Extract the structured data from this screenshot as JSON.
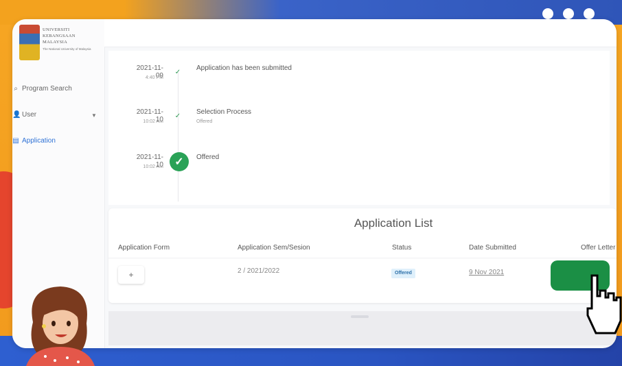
{
  "logo": {
    "lines": [
      "UNIVERSITI",
      "KEBANGSAAN",
      "MALAYSIA"
    ],
    "tagline": "The National University of Malaysia"
  },
  "sidebar": {
    "items": [
      {
        "label": "Program Search",
        "icon": "search-icon"
      },
      {
        "label": "User",
        "icon": "user-icon"
      },
      {
        "label": "Application",
        "icon": "document-icon"
      }
    ]
  },
  "timeline": [
    {
      "date": "2021-11-09",
      "time": "4:40 PM",
      "title": "Application has been submitted",
      "sub": ""
    },
    {
      "date": "2021-11-10",
      "time": "10:02 AM",
      "title": "Selection Process",
      "sub": "Offered"
    },
    {
      "date": "2021-11-10",
      "time": "10:02 AM",
      "title": "Offered",
      "sub": ""
    }
  ],
  "application_list": {
    "title": "Application List",
    "columns": [
      "Application Form",
      "Application Sem/Sesion",
      "Status",
      "Date Submitted",
      "Offer Letter"
    ],
    "rows": [
      {
        "form_button": "+",
        "sem": "2 / 2021/2022",
        "status": "Offered",
        "date": "9 Nov 2021"
      }
    ]
  },
  "colors": {
    "accent": "#2f72d6",
    "success": "#2aa257",
    "offer_button": "#1b8f45",
    "frame_orange": "#f3a21e",
    "frame_blue": "#2f55b8"
  }
}
